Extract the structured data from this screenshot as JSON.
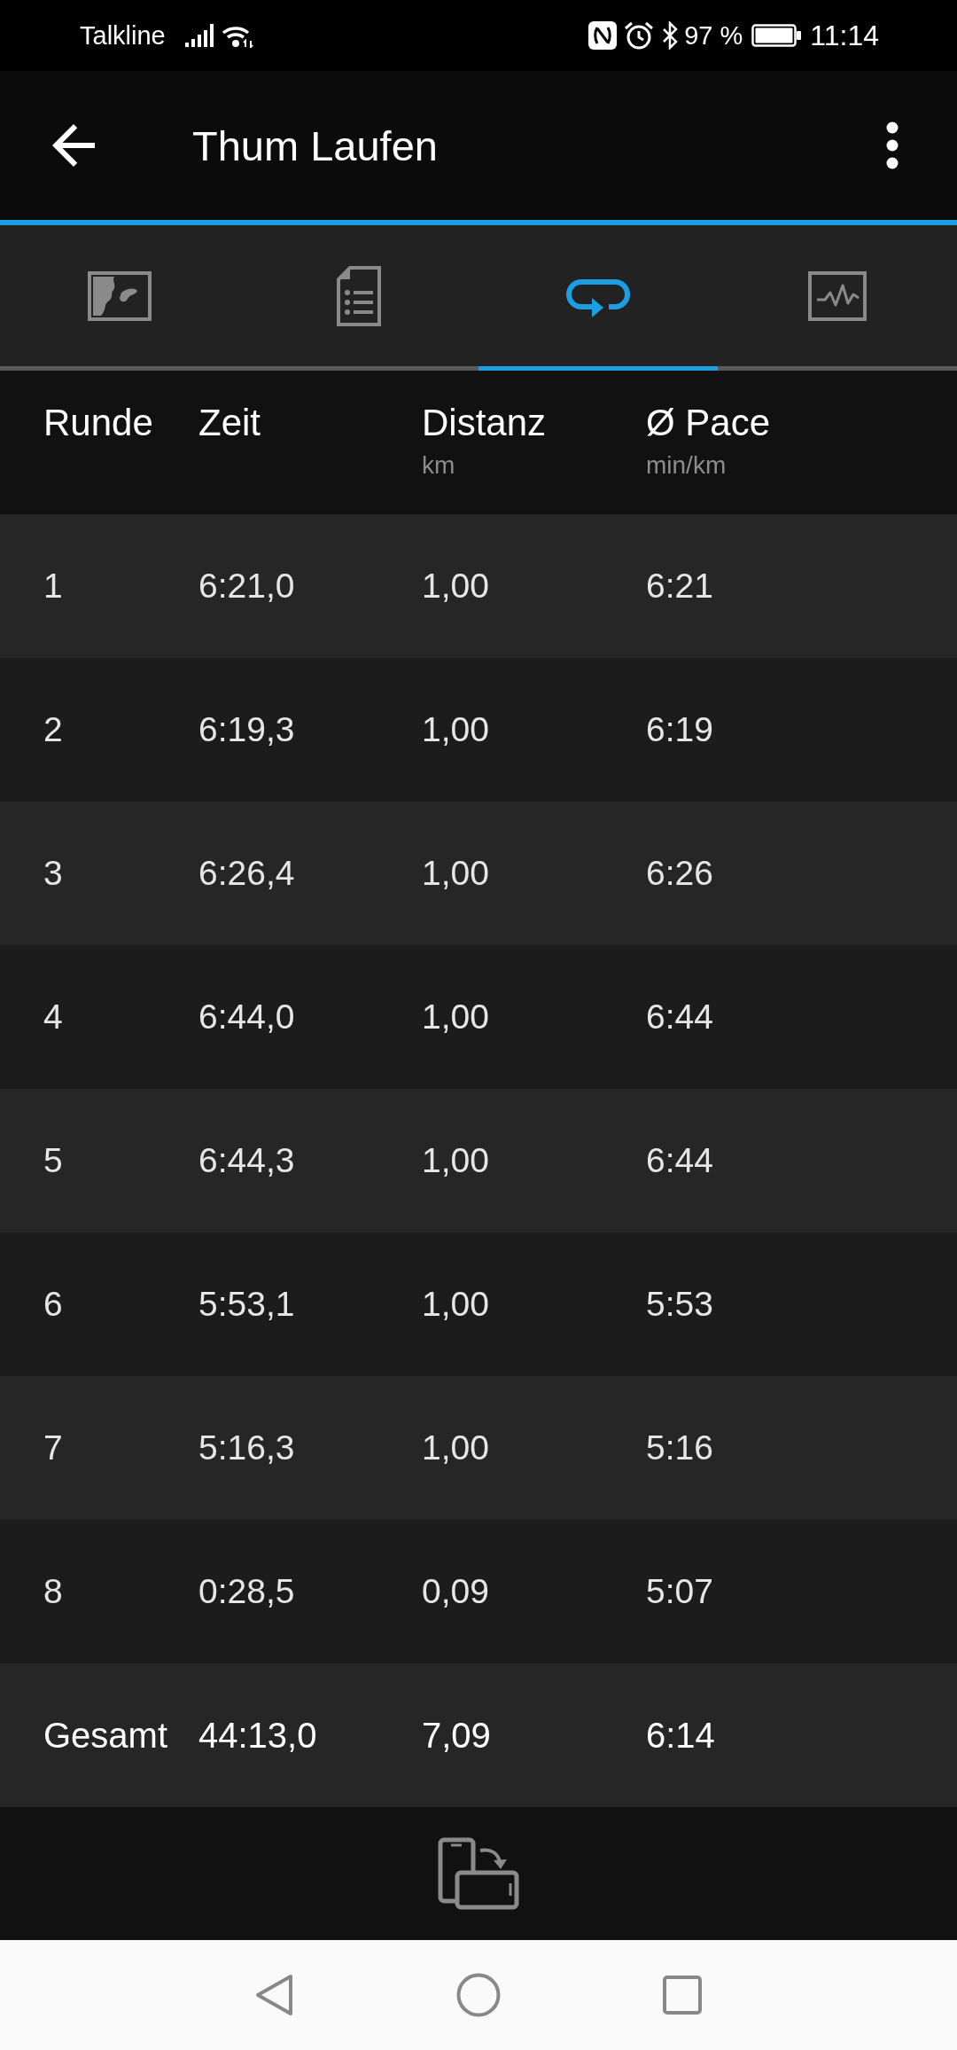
{
  "status_bar": {
    "carrier": "Talkline",
    "battery": "97 %",
    "time": "11:14"
  },
  "app_bar": {
    "title": "Thum Laufen"
  },
  "tabs": [
    {
      "selected": false
    },
    {
      "selected": false
    },
    {
      "selected": true
    },
    {
      "selected": false
    }
  ],
  "table": {
    "columns": [
      {
        "label": "Runde"
      },
      {
        "label": "Zeit"
      },
      {
        "label": "Distanz",
        "unit": "km"
      },
      {
        "label": "Ø Pace",
        "unit": "min/km"
      }
    ],
    "rows": [
      [
        "1",
        "6:21,0",
        "1,00",
        "6:21"
      ],
      [
        "2",
        "6:19,3",
        "1,00",
        "6:19"
      ],
      [
        "3",
        "6:26,4",
        "1,00",
        "6:26"
      ],
      [
        "4",
        "6:44,0",
        "1,00",
        "6:44"
      ],
      [
        "5",
        "6:44,3",
        "1,00",
        "6:44"
      ],
      [
        "6",
        "5:53,1",
        "1,00",
        "5:53"
      ],
      [
        "7",
        "5:16,3",
        "1,00",
        "5:16"
      ],
      [
        "8",
        "0:28,5",
        "0,09",
        "5:07"
      ]
    ],
    "total": [
      "Gesamt",
      "44:13,0",
      "7,09",
      "6:14"
    ]
  }
}
